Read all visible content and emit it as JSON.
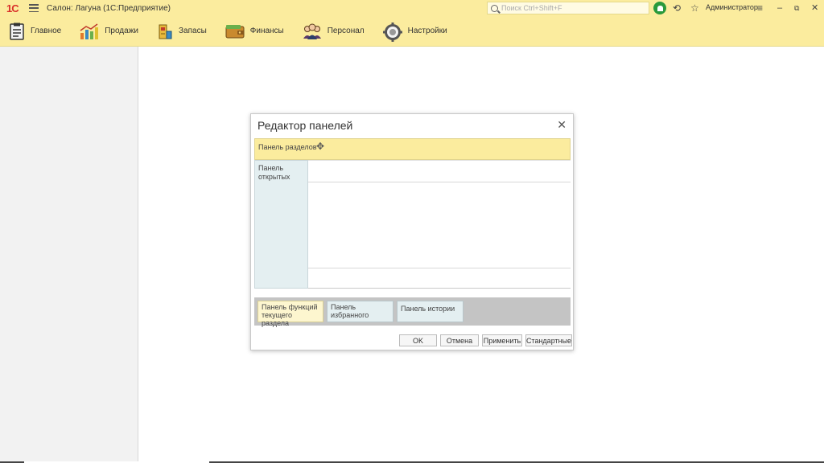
{
  "titlebar": {
    "logo": "1С",
    "title": "Салон: Лагуна  (1С:Предприятие)",
    "search_placeholder": "Поиск Ctrl+Shift+F",
    "user": "Администратор"
  },
  "sections": [
    {
      "label": "Главное",
      "icon": "clipboard-icon"
    },
    {
      "label": "Продажи",
      "icon": "sales-chart-icon"
    },
    {
      "label": "Запасы",
      "icon": "stock-icon"
    },
    {
      "label": "Финансы",
      "icon": "wallet-icon"
    },
    {
      "label": "Персонал",
      "icon": "staff-icon"
    },
    {
      "label": "Настройки",
      "icon": "gear-icon"
    }
  ],
  "dialog": {
    "title": "Редактор панелей",
    "sections_panel": "Панель разделов",
    "open_panel": "Панель открытых",
    "func_panel": "Панель функций текущего раздела",
    "fav_panel": "Панель избранного",
    "history_panel": "Панель истории",
    "buttons": {
      "ok": "OK",
      "cancel": "Отмена",
      "apply": "Применить",
      "standard": "Стандартные"
    }
  }
}
